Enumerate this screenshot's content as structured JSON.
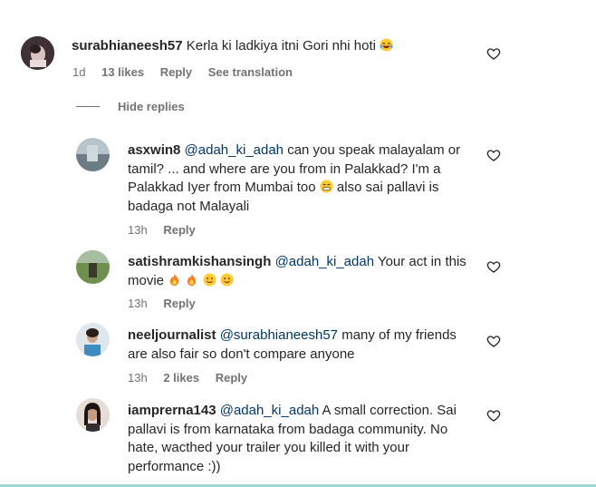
{
  "comments": [
    {
      "username": "surabhianeesh57",
      "text": "Kerla ki ladkiya itni Gori nhi hoti",
      "time": "1d",
      "likes": "13 likes",
      "reply": "Reply",
      "translate": "See translation"
    }
  ],
  "hide_replies": "Hide replies",
  "replies": [
    {
      "username": "asxwin8",
      "mention": "@adah_ki_adah",
      "line1": " can you speak malayalam or",
      "line2": "tamil? ... and where are you from in Palakkad? I'm a",
      "line3": "Palakkad Iyer from Mumbai too",
      "line3b": " also sai pallavi is",
      "line4": "badaga not Malayali",
      "time": "13h",
      "reply": "Reply"
    },
    {
      "username": "satishramkishansingh",
      "mention": "@adah_ki_adah",
      "line1": " Your act in this",
      "line2": "movie",
      "time": "13h",
      "reply": "Reply"
    },
    {
      "username": "neeljournalist",
      "mention": "@surabhianeesh57",
      "line1": " many of my friends",
      "line2": "are also fair so don't compare anyone",
      "time": "13h",
      "likes": "2 likes",
      "reply": "Reply"
    },
    {
      "username": "iamprerna143",
      "mention": "@adah_ki_adah",
      "line1": " A small correction. Sai",
      "line2": "pallavi is from karnataka from badaga community. No",
      "line3": "hate, wacthed your trailer you killed it with your",
      "line4": "performance :))",
      "time": "",
      "reply": ""
    }
  ],
  "icons": {
    "like": "heart-icon",
    "laugh": "laughing-emoji",
    "grin": "grinning-emoji",
    "fire": "fire-emoji",
    "smile": "smiling-emoji"
  }
}
